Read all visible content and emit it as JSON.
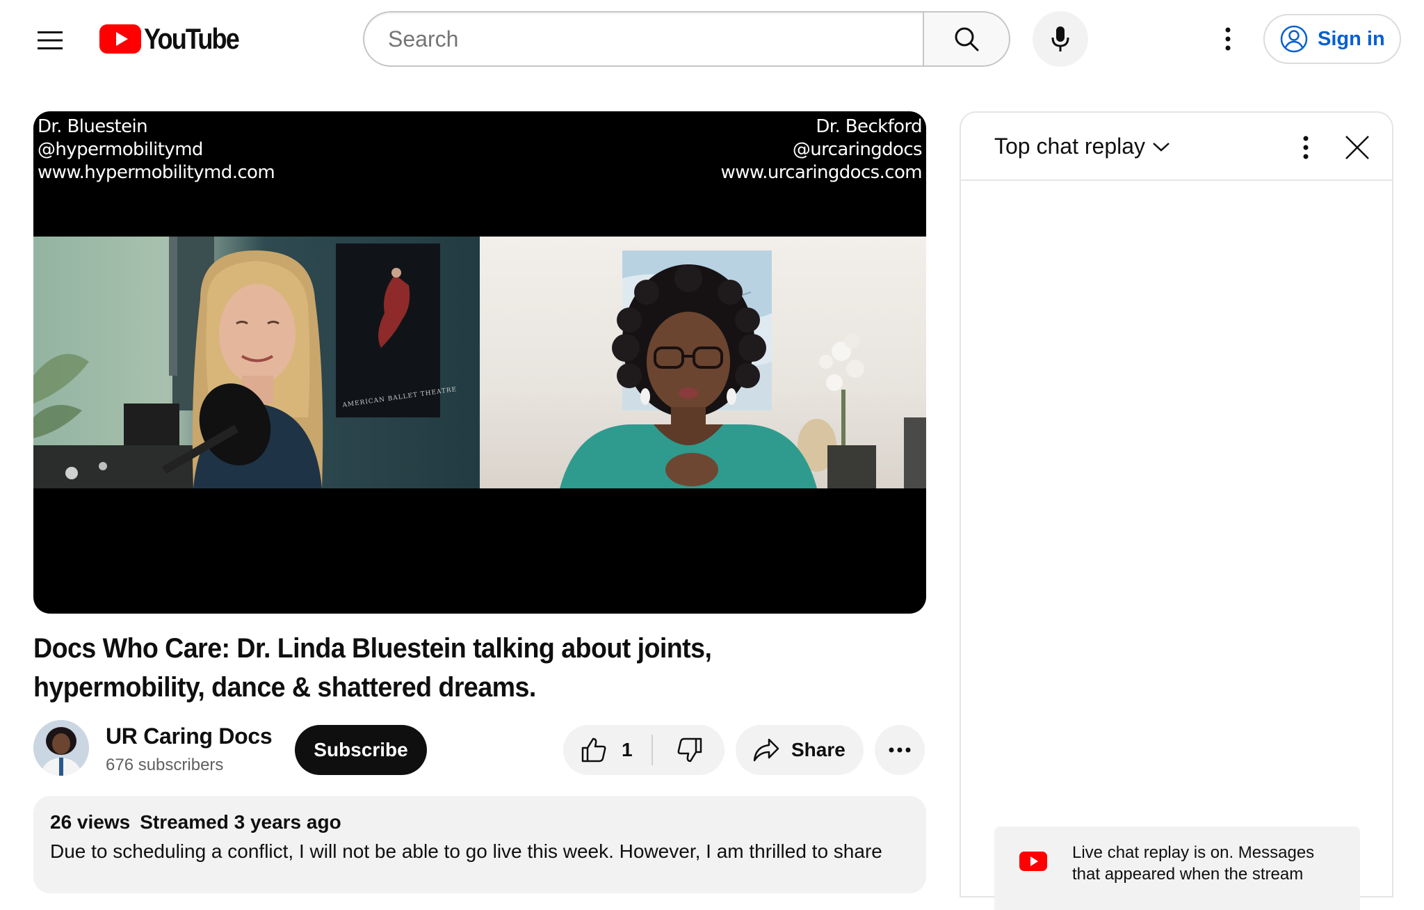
{
  "masthead": {
    "logo_text": "YouTube",
    "search_placeholder": "Search",
    "signin_label": "Sign in"
  },
  "player": {
    "overlay_left": [
      "Dr. Bluestein",
      "@hypermobilitymd",
      "www.hypermobilitymd.com"
    ],
    "overlay_right": [
      "Dr. Beckford",
      "@urcaringdocs",
      "www.urcaringdocs.com"
    ],
    "poster_text": "AMERICAN BALLET THEATRE"
  },
  "video": {
    "title": "Docs Who Care: Dr. Linda Bluestein talking about joints, hypermobility, dance & shattered dreams.",
    "channel_name": "UR Caring Docs",
    "subscribers": "676 subscribers",
    "subscribe_label": "Subscribe",
    "like_count": "1",
    "share_label": "Share"
  },
  "description": {
    "views": "26 views",
    "streamed": "Streamed 3 years ago",
    "text": "Due to scheduling a conflict, I will not be able to go live this week. However, I am thrilled to share"
  },
  "chat": {
    "title": "Top chat replay",
    "notice": "Live chat replay is on. Messages that appeared when the stream"
  },
  "colors": {
    "brand_red": "#ff0000",
    "link_blue": "#065fd4",
    "chip_bg": "#f2f2f2"
  }
}
